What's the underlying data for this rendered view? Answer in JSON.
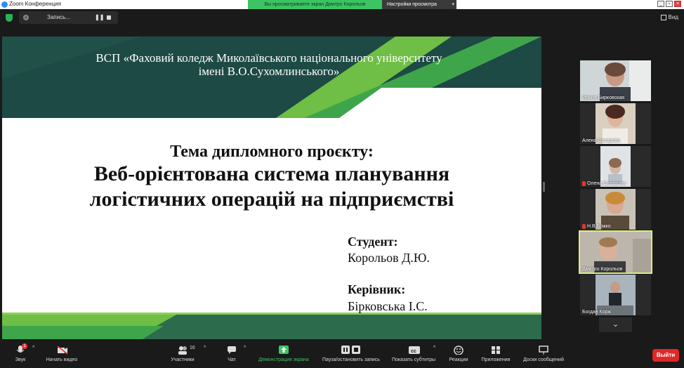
{
  "window": {
    "title": "Zoom Конференция"
  },
  "banner": {
    "sharing_text": "Вы просматриваете экран Дмитро Корольов",
    "view_settings": "Настройки просмотра"
  },
  "recording": {
    "label": "Запись..."
  },
  "view": {
    "label": "Вид"
  },
  "slide": {
    "college_line1": "ВСП «Фаховий коледж Миколаївського національного університету",
    "college_line2": "імені В.О.Сухомлинського»",
    "theme_label": "Тема дипломного проєкту:",
    "theme_line1": "Веб-орієнтована система планування",
    "theme_line2": "логістичних операцій на підприємстві",
    "student_label": "Студент:",
    "student_name": "Корольов Д.Ю.",
    "supervisor_label": "Керівник:",
    "supervisor_name": "Бірковська І.С."
  },
  "participants": [
    {
      "name": "Ирина Бирковская",
      "muted": false
    },
    {
      "name": "Алена Сахарова",
      "muted": false
    },
    {
      "name": "Олена Сахарова",
      "muted": true
    },
    {
      "name": "Н.В.Божко",
      "muted": true
    },
    {
      "name": "Дмитро Корольов",
      "muted": false
    },
    {
      "name": "Богдан Корж",
      "muted": false
    }
  ],
  "toolbar": {
    "audio": "Звук",
    "video": "Начать видео",
    "participants": "Участники",
    "participants_count": "16",
    "chat": "Чат",
    "share": "Демонстрация экрана",
    "pause_record": "Пауза/остановить запись",
    "subtitles": "Показать субтитры",
    "reactions": "Реакции",
    "apps": "Приложения",
    "whiteboards": "Доски сообщений",
    "leave": "Выйти",
    "audio_badge": "1"
  },
  "colors": {
    "accent_green": "#3cc364",
    "leave_red": "#e02828",
    "active_speaker": "#d6f07a",
    "slide_dark": "#173d3a"
  }
}
